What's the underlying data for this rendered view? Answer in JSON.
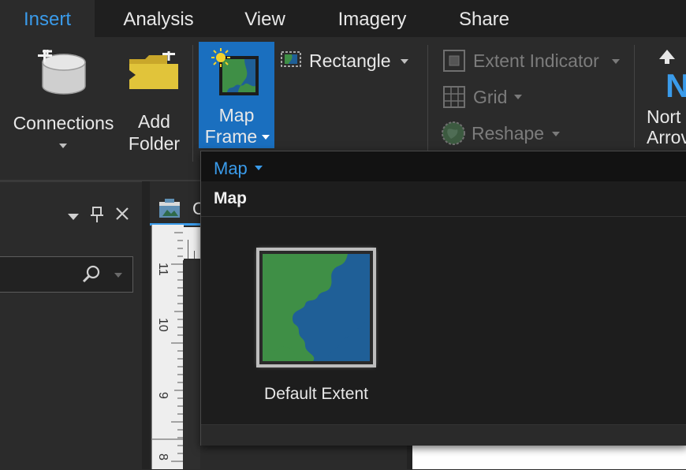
{
  "tabs": [
    "Insert",
    "Analysis",
    "View",
    "Imagery",
    "Share"
  ],
  "ribbon": {
    "connections": "Connections",
    "add_folder": [
      "Add",
      "Folder"
    ],
    "map_frame": [
      "Map",
      "Frame"
    ],
    "rectangle": "Rectangle",
    "extent_indicator": "Extent Indicator",
    "grid": "Grid",
    "reshape": "Reshape",
    "north_arrow": [
      "Nort",
      "Arrov"
    ]
  },
  "view_tab": "C",
  "gallery": {
    "header": "Map",
    "section": "Map",
    "items": [
      {
        "label": "Default Extent"
      }
    ]
  },
  "ruler_labels": [
    "11",
    "10",
    "9",
    "8"
  ],
  "colors": {
    "accent": "#3a9bea",
    "selected_button": "#1a6fbf",
    "map_land": "#3f8f46",
    "map_water": "#1f5f97"
  }
}
